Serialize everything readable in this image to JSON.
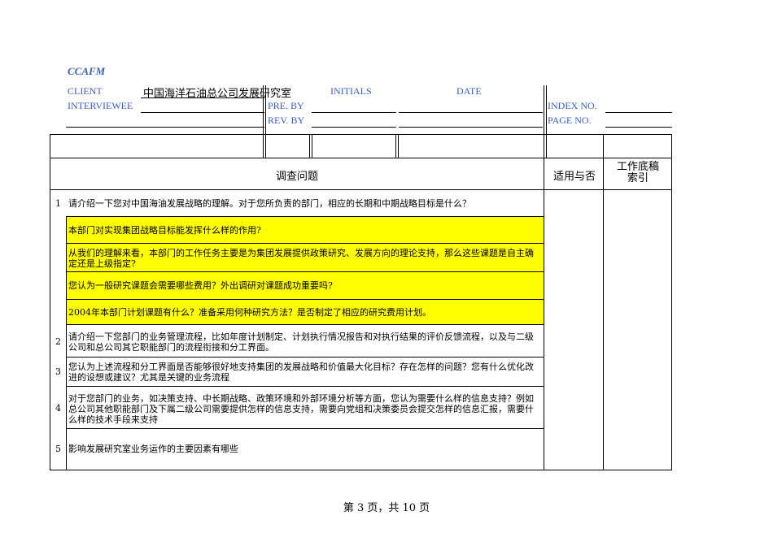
{
  "header": {
    "logo": "CCAFM",
    "client_label": "CLIENT",
    "client_value": "中国海洋石油总公司发展研究室",
    "initials_label": "INITIALS",
    "date_label": "DATE",
    "interviewee_label": "INTERVIEWEE",
    "pre_by_label": "PRE. BY",
    "rev_by_label": "REV. BY",
    "index_no_label": "INDEX NO.",
    "page_no_label": "PAGE NO."
  },
  "table": {
    "col_question": "调查问题",
    "col_applicable": "适用与否",
    "col_index": "工作底稿\n索引",
    "rows": [
      {
        "num": "1",
        "text": "请介绍一下您对中国海油发展战略的理解。对于您所负责的部门，相应的长期和中期战略目标是什么？"
      },
      {
        "num": "",
        "text": "本部门对实现集团战略目标能发挥什么样的作用?"
      },
      {
        "num": "",
        "text": "从我们的理解来看，本部门的工作任务主要是为集团发展提供政策研究、发展方向的理论支持，那么这些课题是自主确定还是上级指定?"
      },
      {
        "num": "",
        "text": "您认为一般研究课题会需要哪些费用？外出调研对课题成功重要吗?"
      },
      {
        "num": "",
        "text": "2004年本部门计划课题有什么？准备采用何种研究方法？是否制定了相应的研究费用计划。"
      },
      {
        "num": "2",
        "text": " 请介绍一下您部门的业务管理流程，比如年度计划制定、计划执行情况报告和对执行结果的评价反馈流程，以及与二级公司和总公司其它职能部门的流程衔接和分工界面。"
      },
      {
        "num": "3",
        "text": "您认为上述流程和分工界面是否能够很好地支持集团的发展战略和价值最大化目标？存在怎样的问题？您有什么优化改进的设想或建议？尤其是关键的业务流程"
      },
      {
        "num": "4",
        "text": "对于您部门的业务，如决策支持、中长期战略、政策环境和外部环境分析等方面，您认为需要什么样的信息支持？例如总公司其他职能部门及下属二级公司需要提供怎样的信息支持，需要向党组和决策委员会提交怎样的信息汇报，需要什么样的技术手段来支持"
      },
      {
        "num": "5",
        "text": "影响发展研究室业务运作的主要因素有哪些"
      }
    ]
  },
  "footer": {
    "page_text": "第 3 页，共 10 页"
  },
  "colors": {
    "label_blue": "#3b5fc0",
    "highlight": "#ffff00"
  }
}
